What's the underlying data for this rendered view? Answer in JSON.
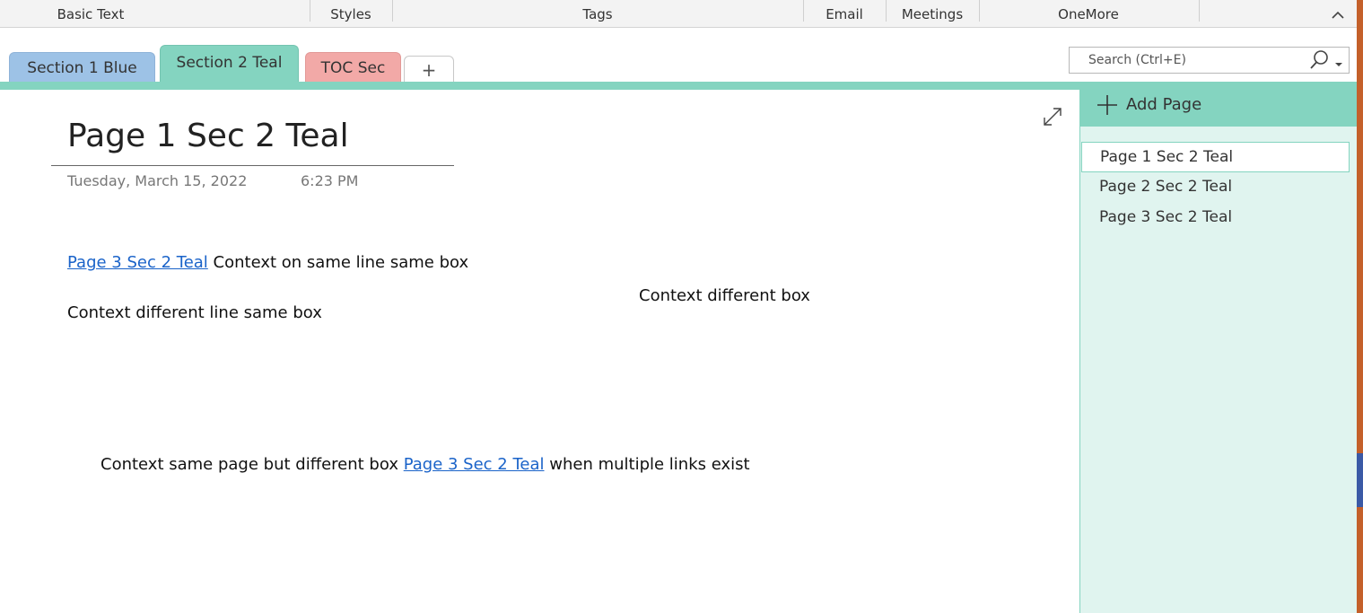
{
  "ribbon": {
    "groups": [
      "Basic Text",
      "Styles",
      "Tags",
      "Email",
      "Meetings",
      "OneMore"
    ]
  },
  "sections": {
    "tabs": [
      "Section 1 Blue",
      "Section 2 Teal",
      "TOC Sec"
    ],
    "add_label": "+",
    "colors": {
      "blue": "#9dc2e6",
      "teal": "#84d4c0",
      "toc": "#f2a9a7"
    }
  },
  "search": {
    "placeholder": "Search (Ctrl+E)"
  },
  "page": {
    "title": "Page 1 Sec 2 Teal",
    "date": "Tuesday, March 15, 2022",
    "time": "6:23 PM",
    "note1": {
      "link": "Page 3 Sec 2 Teal",
      "text": " Context on same line same box"
    },
    "note2": "Context different line same box",
    "note3": "Context different box",
    "note4": {
      "before": "Context same page but different box ",
      "link": "Page 3 Sec 2 Teal",
      "after": " when multiple links exist"
    },
    "link_color": "#1a63c9"
  },
  "pages_pane": {
    "add_page_label": "Add Page",
    "pages": [
      "Page 1 Sec 2 Teal",
      "Page 2 Sec 2 Teal",
      "Page 3 Sec 2 Teal"
    ],
    "selected": 0
  },
  "icons": [
    "chevron-up-icon",
    "search-icon",
    "dropdown-arrow-icon",
    "expand-icon",
    "plus-icon"
  ]
}
